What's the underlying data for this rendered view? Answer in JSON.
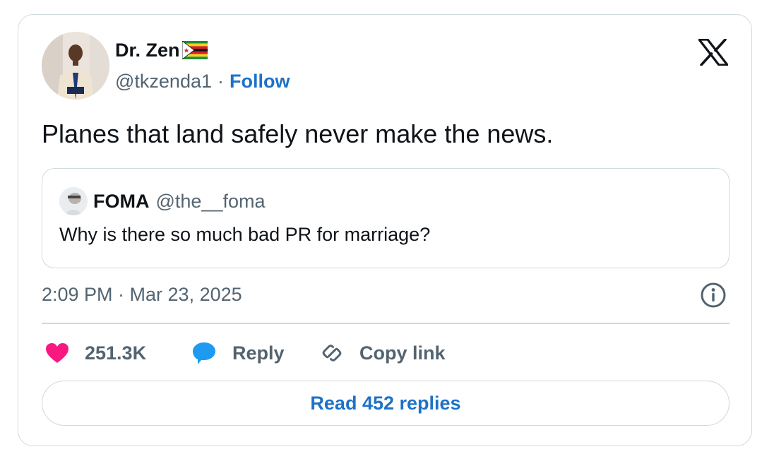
{
  "author": {
    "name": "Dr. Zen",
    "handle": "@tkzenda1",
    "separator": "·",
    "follow_label": "Follow",
    "flag_icon": "zimbabwe-flag-icon",
    "avatar_icon": "author-avatar"
  },
  "tweet": {
    "text": "Planes that land safely never make the news.",
    "timestamp": "2:09 PM · Mar 23, 2025"
  },
  "quoted": {
    "name": "FOMA",
    "handle": "@the__foma",
    "text": "Why is there so much bad PR for marriage?"
  },
  "actions": {
    "like_count": "251.3K",
    "reply_label": "Reply",
    "copy_label": "Copy link",
    "read_replies_label": "Read 452 replies"
  },
  "colors": {
    "like": "#f91880",
    "reply": "#1d9bf0",
    "link": "#1d72c8",
    "border": "#cfd9de",
    "muted": "#536471"
  },
  "icons": {
    "brand": "x-logo-icon",
    "info": "info-icon",
    "like": "heart-icon",
    "reply": "speech-bubble-icon",
    "copy": "link-icon"
  }
}
